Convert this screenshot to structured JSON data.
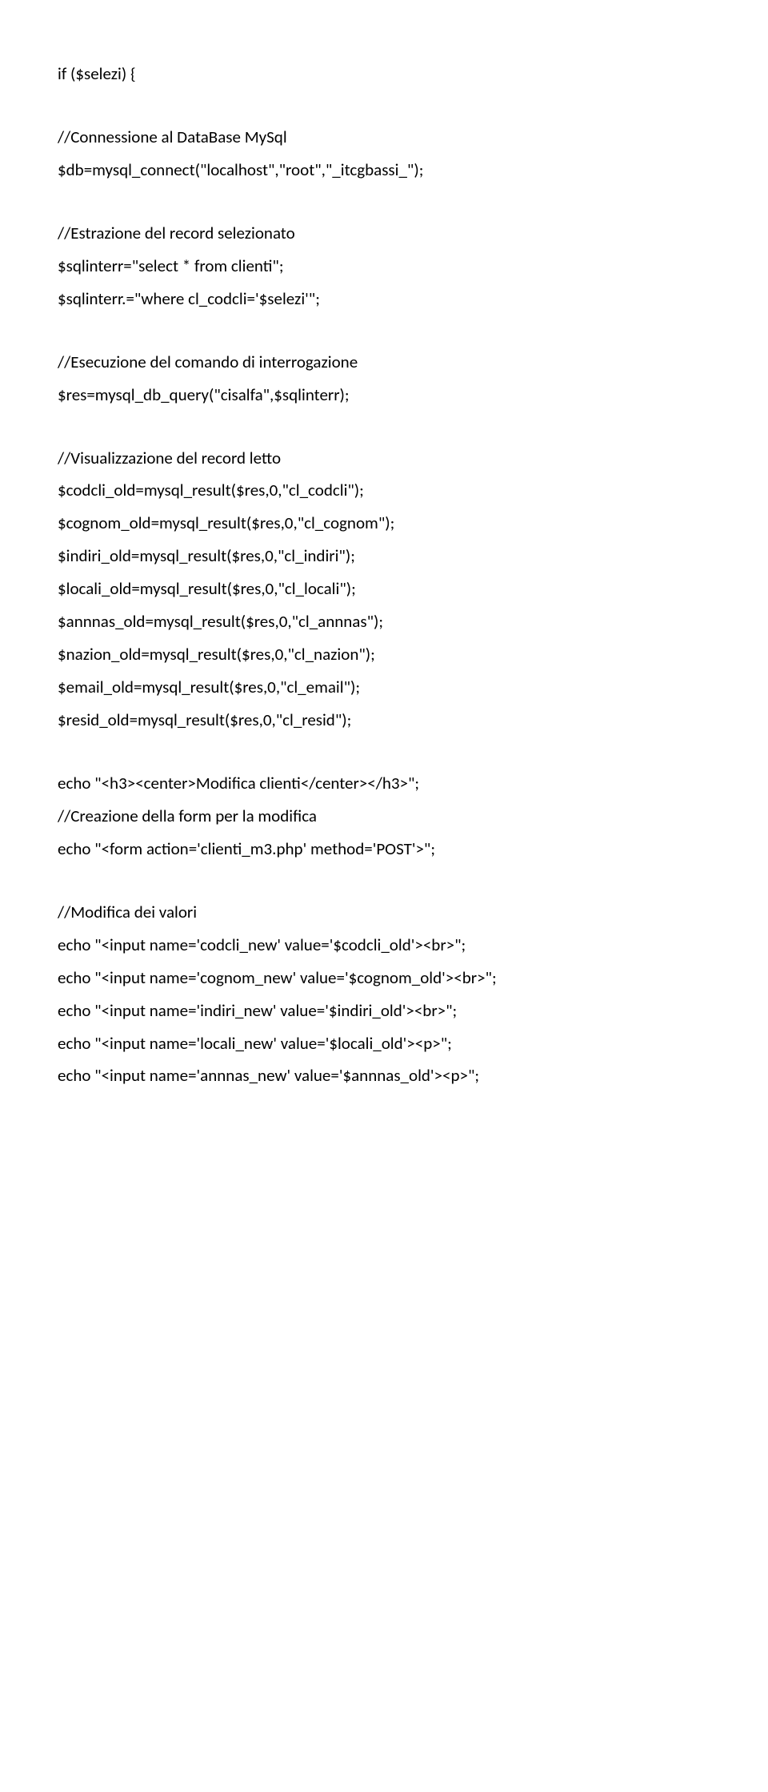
{
  "lines": [
    "if ($selezi) {",
    "",
    "//Connessione al DataBase MySql",
    "$db=mysql_connect(\"localhost\",\"root\",\"_itcgbassi_\");",
    "",
    "//Estrazione del record selezionato",
    "$sqlinterr=\"select * from clienti\";",
    "$sqlinterr.=\"where cl_codcli='$selezi'\";",
    "",
    "//Esecuzione del comando di interrogazione",
    "$res=mysql_db_query(\"cisalfa\",$sqlinterr);",
    "",
    "//Visualizzazione del record letto",
    "$codcli_old=mysql_result($res,0,\"cl_codcli\");",
    "$cognom_old=mysql_result($res,0,\"cl_cognom\");",
    "$indiri_old=mysql_result($res,0,\"cl_indiri\");",
    "$locali_old=mysql_result($res,0,\"cl_locali\");",
    "$annnas_old=mysql_result($res,0,\"cl_annnas\");",
    "$nazion_old=mysql_result($res,0,\"cl_nazion\");",
    "$email_old=mysql_result($res,0,\"cl_email\");",
    "$resid_old=mysql_result($res,0,\"cl_resid\");",
    "",
    "echo \"<h3><center>Modifica clienti</center></h3>\";",
    "//Creazione della form per la modifica",
    "echo \"<form action='clienti_m3.php' method='POST'>\";",
    "",
    "//Modifica dei valori",
    "echo \"<input name='codcli_new' value='$codcli_old'><br>\";",
    "echo \"<input name='cognom_new' value='$cognom_old'><br>\";",
    "echo \"<input name='indiri_new' value='$indiri_old'><br>\";",
    "echo \"<input name='locali_new' value='$locali_old'><p>\";",
    "echo \"<input name='annnas_new' value='$annnas_old'><p>\";"
  ]
}
